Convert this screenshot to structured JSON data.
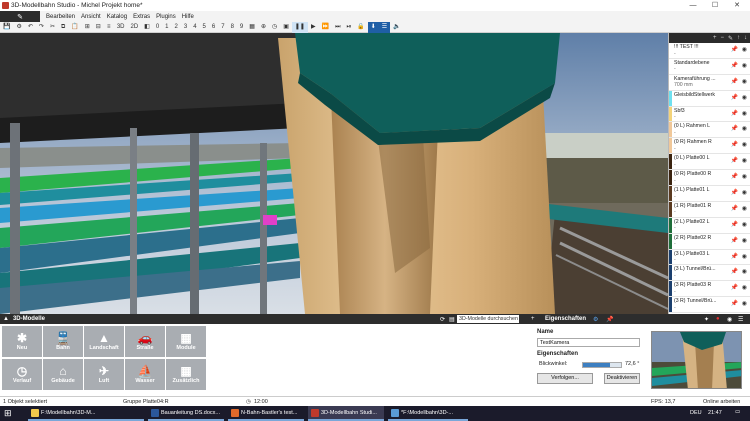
{
  "window": {
    "title": "3D-Modellbahn Studio - Michel Projekt home*",
    "min": "—",
    "max": "☐",
    "close": "✕"
  },
  "menu": {
    "file_icon": "pencil-icon",
    "items": [
      "Bearbeiten",
      "Ansicht",
      "Katalog",
      "Extras",
      "Plugins",
      "Hilfe"
    ]
  },
  "toolbar": {
    "view_labels": [
      "3D",
      "2D"
    ],
    "layer_numbers": [
      "0",
      "1",
      "2",
      "3",
      "4",
      "5",
      "6",
      "7",
      "8",
      "9"
    ]
  },
  "layers": {
    "items": [
      {
        "label": "!!! TEST !!!",
        "sub": "-",
        "color": "#ffffff"
      },
      {
        "label": "Standardebene",
        "sub": "-",
        "color": "#ffffff"
      },
      {
        "label": "Kameraführung ...",
        "sub": "700 mm",
        "color": "#ffffff"
      },
      {
        "label": "GleisbildStellwerk",
        "sub": "",
        "color": "#6fe0ef"
      },
      {
        "label": "Sbf3",
        "sub": "-",
        "color": "#f3d37a"
      },
      {
        "label": "(0 L) Rahmen L",
        "sub": "-",
        "color": "#f0c89a"
      },
      {
        "label": "(0 R) Rahmen R",
        "sub": "-",
        "color": "#f0c89a"
      },
      {
        "label": "(0 L) Platte00 L",
        "sub": "-",
        "color": "#3b2410"
      },
      {
        "label": "(0 R) Platte00 R",
        "sub": "-",
        "color": "#3b2410"
      },
      {
        "label": "(1 L) Platte01 L",
        "sub": "-",
        "color": "#5a3a20"
      },
      {
        "label": "(1 R) Platte01 R",
        "sub": "-",
        "color": "#5a3a20"
      },
      {
        "label": "(2 L) Platte02 L",
        "sub": "-",
        "color": "#1f6e3a"
      },
      {
        "label": "(2 R) Platte02 R",
        "sub": "-",
        "color": "#1f6e3a"
      },
      {
        "label": "(3 L) Platte03 L",
        "sub": "-",
        "color": "#1b3f6e"
      },
      {
        "label": "(3 L) Tunnel/Brü...",
        "sub": "-",
        "color": "#1b3f6e"
      },
      {
        "label": "(3 R) Platte03 R",
        "sub": "-",
        "color": "#1b3f6e"
      },
      {
        "label": "(3 R) Tunnel/Brü...",
        "sub": "-",
        "color": "#1b3f6e"
      }
    ]
  },
  "catalog": {
    "title": "3D-Modelle",
    "search_placeholder": "3D-Modelle durchsuchen",
    "tiles": [
      {
        "label": "Neu",
        "icon": "asterisk-icon",
        "glyph": "✱"
      },
      {
        "label": "Bahn",
        "icon": "train-icon",
        "glyph": "🚆"
      },
      {
        "label": "Landschaft",
        "icon": "tree-icon",
        "glyph": "▲"
      },
      {
        "label": "Straße",
        "icon": "car-icon",
        "glyph": "🚗"
      },
      {
        "label": "Module",
        "icon": "grid-icon",
        "glyph": "▦"
      },
      {
        "label": "Verlauf",
        "icon": "clock-icon",
        "glyph": "◷"
      },
      {
        "label": "Gebäude",
        "icon": "house-icon",
        "glyph": "⌂"
      },
      {
        "label": "Luft",
        "icon": "plane-icon",
        "glyph": "✈"
      },
      {
        "label": "Wasser",
        "icon": "boat-icon",
        "glyph": "⛵"
      },
      {
        "label": "Zusätzlich",
        "icon": "grid-icon",
        "glyph": "▦"
      }
    ]
  },
  "properties": {
    "panel_title": "Eigenschaften",
    "name_heading": "Name",
    "name_value": "TestKamera",
    "props_heading": "Eigenschaften",
    "fov_label": "Blickwinkel:",
    "fov_value": "72,6 °",
    "fov_fraction": 0.72,
    "btn_follow": "Verfolgen...",
    "btn_deactivate": "Deaktivieren"
  },
  "status": {
    "selection": "1 Objekt selektiert",
    "group": "Gruppe Platte04:R",
    "time": "12:00",
    "fps": "FPS: 13,7",
    "online": "Online arbeiten"
  },
  "taskbar": {
    "tasks": [
      {
        "label": "F:\\Modellbahn\\3D-M...",
        "color": "#f2c94c"
      },
      {
        "label": "Bauanleitung DS.docx...",
        "color": "#2b579a"
      },
      {
        "label": "N-Bahn-Bastler's test...",
        "color": "#e06a2b"
      },
      {
        "label": "3D-Modellbahn Studi...",
        "color": "#c0392b"
      },
      {
        "label": "*F:\\Modellbahn\\3D-...",
        "color": "#5a9bd5"
      }
    ],
    "lang": "DEU",
    "clock": "21:47"
  }
}
